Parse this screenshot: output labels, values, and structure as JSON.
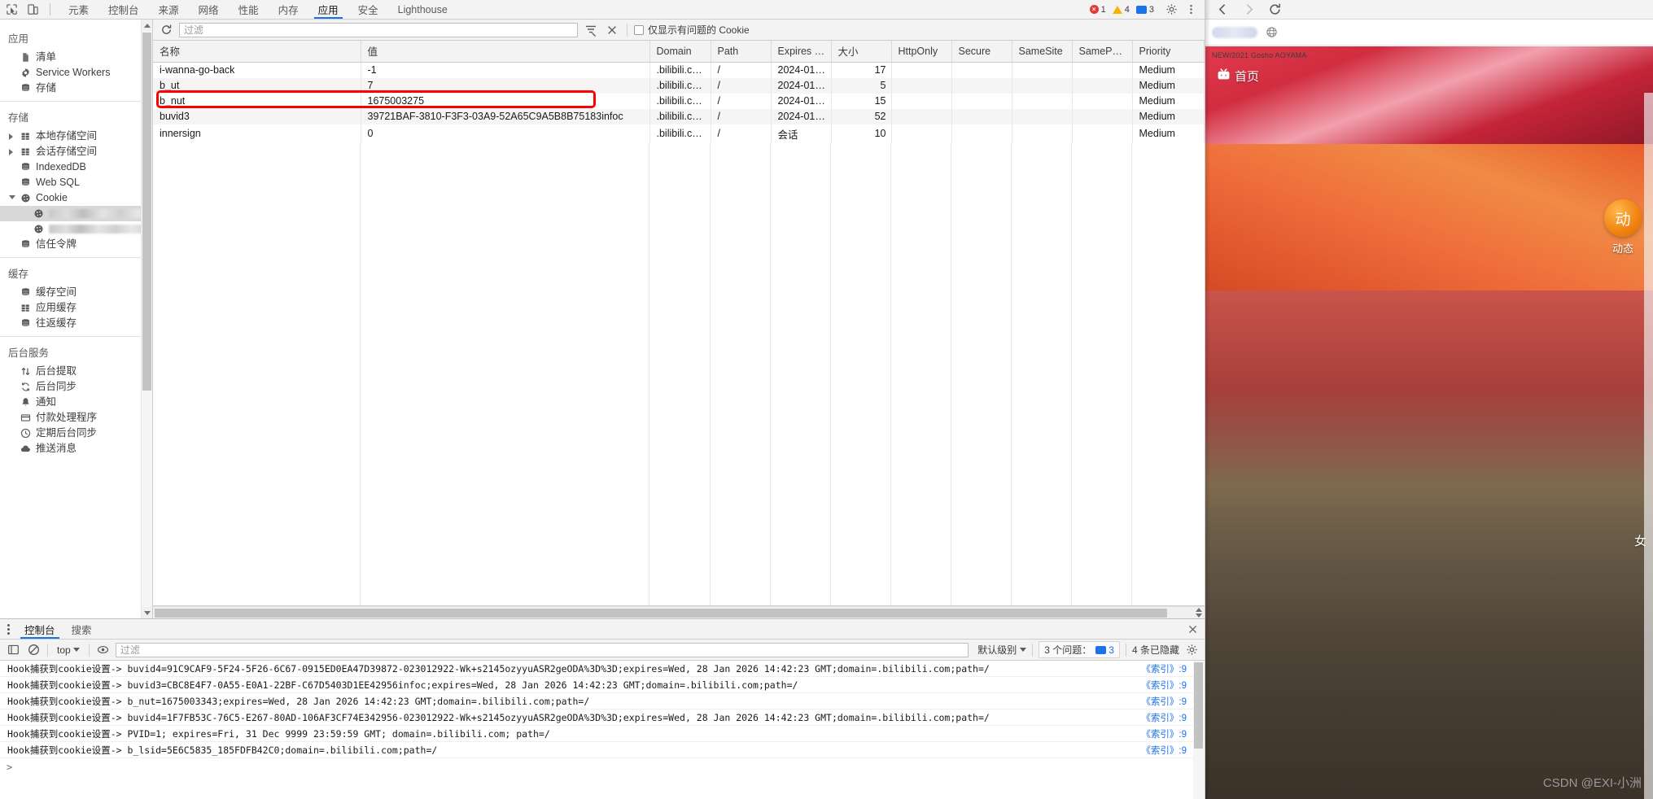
{
  "devtools": {
    "tabs": [
      {
        "label": "元素",
        "active": false
      },
      {
        "label": "控制台",
        "active": false
      },
      {
        "label": "来源",
        "active": false
      },
      {
        "label": "网络",
        "active": false
      },
      {
        "label": "性能",
        "active": false
      },
      {
        "label": "内存",
        "active": false
      },
      {
        "label": "应用",
        "active": true
      },
      {
        "label": "安全",
        "active": false
      },
      {
        "label": "Lighthouse",
        "active": false
      }
    ],
    "status_badges": {
      "errors": "1",
      "warnings": "4",
      "messages": "3"
    },
    "icons": {
      "inspect": "inspect-element-icon",
      "device": "device-toolbar-icon",
      "settings": "gear-icon",
      "more": "more-vertical-icon"
    }
  },
  "sidebar": {
    "groups": [
      {
        "title": "应用",
        "items": [
          {
            "label": "清单",
            "icon": "manifest-icon",
            "indent": 0,
            "arrow": "none",
            "selected": false
          },
          {
            "label": "Service Workers",
            "icon": "gear-icon",
            "indent": 0,
            "arrow": "none",
            "selected": false
          },
          {
            "label": "存储",
            "icon": "database-icon",
            "indent": 0,
            "arrow": "none",
            "selected": false
          }
        ]
      },
      {
        "title": "存储",
        "items": [
          {
            "label": "本地存储空间",
            "icon": "table-icon",
            "indent": 0,
            "arrow": "closed",
            "selected": false
          },
          {
            "label": "会话存储空间",
            "icon": "table-icon",
            "indent": 0,
            "arrow": "closed",
            "selected": false
          },
          {
            "label": "IndexedDB",
            "icon": "database-icon",
            "indent": 0,
            "arrow": "none",
            "selected": false
          },
          {
            "label": "Web SQL",
            "icon": "database-icon",
            "indent": 0,
            "arrow": "none",
            "selected": false
          },
          {
            "label": "Cookie",
            "icon": "cookie-icon",
            "indent": 0,
            "arrow": "open",
            "selected": false
          },
          {
            "label": "",
            "icon": "cookie-icon",
            "indent": 1,
            "arrow": "none",
            "selected": true,
            "blurred": "a"
          },
          {
            "label": "",
            "icon": "cookie-icon",
            "indent": 1,
            "arrow": "none",
            "selected": false,
            "blurred": "b"
          },
          {
            "label": "信任令牌",
            "icon": "database-icon",
            "indent": 0,
            "arrow": "none",
            "selected": false
          }
        ]
      },
      {
        "title": "缓存",
        "items": [
          {
            "label": "缓存空间",
            "icon": "database-icon",
            "indent": 0,
            "arrow": "none",
            "selected": false
          },
          {
            "label": "应用缓存",
            "icon": "table-icon",
            "indent": 0,
            "arrow": "none",
            "selected": false
          },
          {
            "label": "往返缓存",
            "icon": "database-icon",
            "indent": 0,
            "arrow": "none",
            "selected": false
          }
        ]
      },
      {
        "title": "后台服务",
        "items": [
          {
            "label": "后台提取",
            "icon": "arrows-updown-icon",
            "indent": 0,
            "arrow": "none",
            "selected": false
          },
          {
            "label": "后台同步",
            "icon": "sync-icon",
            "indent": 0,
            "arrow": "none",
            "selected": false
          },
          {
            "label": "通知",
            "icon": "bell-icon",
            "indent": 0,
            "arrow": "none",
            "selected": false
          },
          {
            "label": "付款处理程序",
            "icon": "card-icon",
            "indent": 0,
            "arrow": "none",
            "selected": false
          },
          {
            "label": "定期后台同步",
            "icon": "clock-icon",
            "indent": 0,
            "arrow": "none",
            "selected": false
          },
          {
            "label": "推送消息",
            "icon": "cloud-icon",
            "indent": 0,
            "arrow": "none",
            "selected": false
          }
        ]
      }
    ]
  },
  "cookie_toolbar": {
    "refresh_title": "refresh-icon",
    "filter_placeholder": "过滤",
    "filter_value": "",
    "clear_all_title": "clear-filter-icon",
    "delete_title": "close-icon",
    "checkbox_label": "仅显示有问题的 Cookie",
    "checkbox_checked": false
  },
  "cookie_table": {
    "columns": [
      "名称",
      "值",
      "Domain",
      "Path",
      "Expires / ...",
      "大小",
      "HttpOnly",
      "Secure",
      "SameSite",
      "SameParty",
      "Priority"
    ],
    "rows": [
      {
        "name": "i-wanna-go-back",
        "value": "-1",
        "domain": ".bilibili.com",
        "path": "/",
        "expires": "2024-01-2...",
        "size": "17",
        "httponly": "",
        "secure": "",
        "samesite": "",
        "sameparty": "",
        "priority": "Medium",
        "highlighted": false
      },
      {
        "name": "b_ut",
        "value": "7",
        "domain": ".bilibili.com",
        "path": "/",
        "expires": "2024-01-2...",
        "size": "5",
        "httponly": "",
        "secure": "",
        "samesite": "",
        "sameparty": "",
        "priority": "Medium",
        "highlighted": false
      },
      {
        "name": "b_nut",
        "value": "1675003275",
        "domain": ".bilibili.com",
        "path": "/",
        "expires": "2024-01-2...",
        "size": "15",
        "httponly": "",
        "secure": "",
        "samesite": "",
        "sameparty": "",
        "priority": "Medium",
        "highlighted": false
      },
      {
        "name": "buvid3",
        "value": "39721BAF-3810-F3F3-03A9-52A65C9A5B8B75183infoc",
        "domain": ".bilibili.com",
        "path": "/",
        "expires": "2024-01-2...",
        "size": "52",
        "httponly": "",
        "secure": "",
        "samesite": "",
        "sameparty": "",
        "priority": "Medium",
        "highlighted": true
      },
      {
        "name": "innersign",
        "value": "0",
        "domain": ".bilibili.com",
        "path": "/",
        "expires": "会话",
        "size": "10",
        "httponly": "",
        "secure": "",
        "samesite": "",
        "sameparty": "",
        "priority": "Medium",
        "highlighted": false
      }
    ]
  },
  "drawer": {
    "tabs": [
      {
        "label": "控制台",
        "active": true
      },
      {
        "label": "搜索",
        "active": false
      }
    ],
    "close_icon": "close-icon",
    "toolbar": {
      "sidebar_toggle_icon": "console-sidebar-icon",
      "clear_icon": "clear-console-icon",
      "context": "top",
      "eye_icon": "live-expression-icon",
      "filter_placeholder": "过滤",
      "filter_value": "",
      "level": "默认级别",
      "issues_label": "3 个问题：",
      "issues_count": "3",
      "hidden_label": "4 条已隐藏",
      "settings_icon": "gear-icon"
    },
    "log_lines": [
      {
        "message": "Hook捕获到cookie设置-> buvid4=91C9CAF9-5F24-5F26-6C67-0915ED0EA47D39872-023012922-Wk+s2145ozyyuASR2geODA%3D%3D;expires=Wed, 28 Jan 2026 14:42:23 GMT;domain=.bilibili.com;path=/",
        "source": "《索引》:9"
      },
      {
        "message": "Hook捕获到cookie设置-> buvid3=CBC8E4F7-0A55-E0A1-22BF-C67D5403D1EE42956infoc;expires=Wed, 28 Jan 2026 14:42:23 GMT;domain=.bilibili.com;path=/",
        "source": "《索引》:9"
      },
      {
        "message": "Hook捕获到cookie设置-> b_nut=1675003343;expires=Wed, 28 Jan 2026 14:42:23 GMT;domain=.bilibili.com;path=/",
        "source": "《索引》:9"
      },
      {
        "message": "Hook捕获到cookie设置-> buvid4=1F7FB53C-76C5-E267-80AD-106AF3CF74E342956-023012922-Wk+s2145ozyyuASR2geODA%3D%3D;expires=Wed, 28 Jan 2026 14:42:23 GMT;domain=.bilibili.com;path=/",
        "source": "《索引》:9"
      },
      {
        "message": "Hook捕获到cookie设置-> PVID=1; expires=Fri, 31 Dec 9999 23:59:59 GMT; domain=.bilibili.com; path=/",
        "source": "《索引》:9"
      },
      {
        "message": "Hook捕获到cookie设置-> b_lsid=5E6C5835_185FDFB42C0;domain=.bilibili.com;path=/",
        "source": "《索引》:9"
      }
    ],
    "prompt": ">"
  },
  "browser_page": {
    "nav_icons": {
      "back": "back-arrow-icon",
      "forward": "forward-arrow-icon",
      "reload": "reload-icon"
    },
    "top_text": "NEW/2021 Gosho AOYAMA",
    "home_label": "首页",
    "home_icon": "tv-icon",
    "float_icon": "activity-icon",
    "float_label": "动态",
    "side_vertical_text": "女",
    "watermark": "CSDN @EXI-小洲"
  }
}
